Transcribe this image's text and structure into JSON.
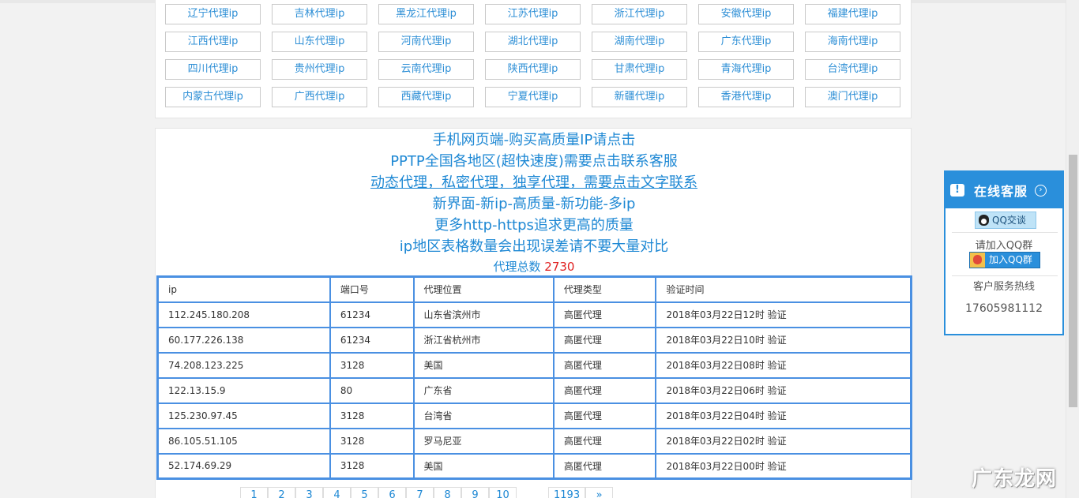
{
  "regions": [
    "辽宁代理ip",
    "吉林代理ip",
    "黑龙江代理ip",
    "江苏代理ip",
    "浙江代理ip",
    "安徽代理ip",
    "福建代理ip",
    "江西代理ip",
    "山东代理ip",
    "河南代理ip",
    "湖北代理ip",
    "湖南代理ip",
    "广东代理ip",
    "海南代理ip",
    "四川代理ip",
    "贵州代理ip",
    "云南代理ip",
    "陕西代理ip",
    "甘肃代理ip",
    "青海代理ip",
    "台湾代理ip",
    "内蒙古代理ip",
    "广西代理ip",
    "西藏代理ip",
    "宁夏代理ip",
    "新疆代理ip",
    "香港代理ip",
    "澳门代理ip"
  ],
  "promo": {
    "line1": "手机网页端-购买高质量IP请点击",
    "line2": "PPTP全国各地区(超快速度)需要点击联系客服",
    "line3": "动态代理，私密代理，独享代理，需要点击文字联系",
    "line4": "新界面-新ip-高质量-新功能-多ip",
    "line5": "更多http-https追求更高的质量",
    "line6": "ip地区表格数量会出现误差请不要大量对比",
    "total_label": "代理总数",
    "total_value": "2730"
  },
  "table": {
    "headers": [
      "ip",
      "端口号",
      "代理位置",
      "代理类型",
      "验证时间"
    ],
    "rows": [
      [
        "112.245.180.208",
        "61234",
        "山东省滨州市",
        "高匿代理",
        "2018年03月22日12时 验证"
      ],
      [
        "60.177.226.138",
        "61234",
        "浙江省杭州市",
        "高匿代理",
        "2018年03月22日10时 验证"
      ],
      [
        "74.208.123.225",
        "3128",
        "美国",
        "高匿代理",
        "2018年03月22日08时 验证"
      ],
      [
        "122.13.15.9",
        "80",
        "广东省",
        "高匿代理",
        "2018年03月22日06时 验证"
      ],
      [
        "125.230.97.45",
        "3128",
        "台湾省",
        "高匿代理",
        "2018年03月22日04时 验证"
      ],
      [
        "86.105.51.105",
        "3128",
        "罗马尼亚",
        "高匿代理",
        "2018年03月22日02时 验证"
      ],
      [
        "52.174.69.29",
        "3128",
        "美国",
        "高匿代理",
        "2018年03月22日00时 验证"
      ]
    ]
  },
  "pager": {
    "pages": [
      "1",
      "2",
      "3",
      "4",
      "5",
      "6",
      "7",
      "8",
      "9",
      "10"
    ],
    "last": "1193",
    "next": "»"
  },
  "service": {
    "title": "在线客服",
    "qq_chat": "QQ交谈",
    "join_group_label": "请加入QQ群",
    "join_group_button": "加入QQ群",
    "hotline_label": "客户服务热线",
    "hotline_number": "17605981112"
  },
  "watermark": "广东龙网",
  "colors": {
    "accent": "#2a8fdb",
    "link": "#1e88d4",
    "total_number": "#e02020",
    "table_border": "#4a90e2"
  },
  "icons": {
    "service_head": "chat-bubble-icon",
    "service_arrow": "chevron-right-circle-icon",
    "qq": "qq-penguin-icon",
    "group": "qq-group-icon"
  }
}
